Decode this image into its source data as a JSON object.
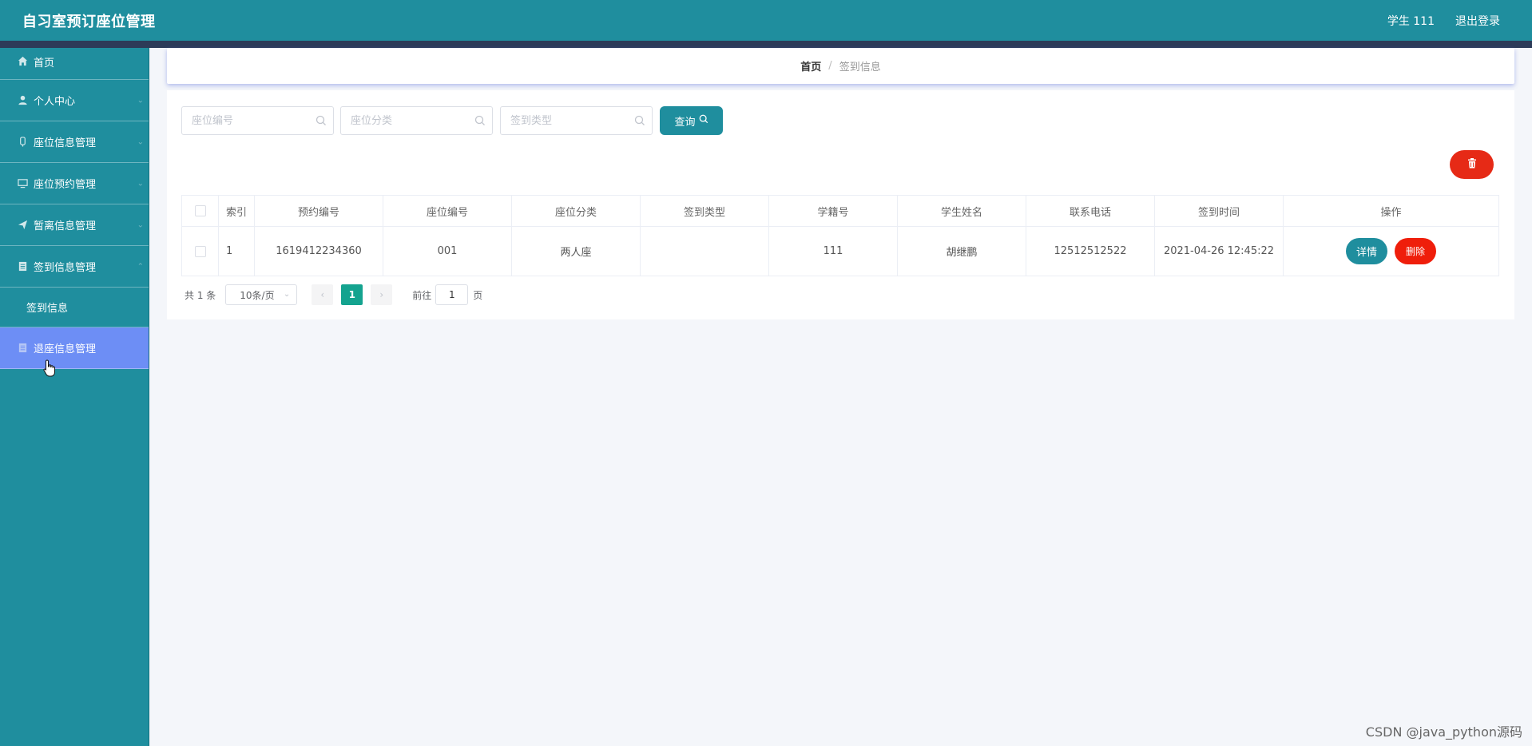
{
  "header": {
    "title": "自习室预订座位管理",
    "user": "学生 111",
    "logout": "退出登录"
  },
  "sidebar": {
    "items": [
      {
        "label": "首页",
        "icon": "home-icon"
      },
      {
        "label": "个人中心",
        "icon": "user-icon"
      },
      {
        "label": "座位信息管理",
        "icon": "seat-icon"
      },
      {
        "label": "座位预约管理",
        "icon": "monitor-icon"
      },
      {
        "label": "暂离信息管理",
        "icon": "send-icon"
      },
      {
        "label": "签到信息管理",
        "icon": "document-icon"
      },
      {
        "label": "退座信息管理",
        "icon": "document-icon"
      }
    ],
    "submenu": {
      "label": "签到信息"
    }
  },
  "breadcrumb": {
    "home": "首页",
    "separator": "/",
    "current": "签到信息"
  },
  "search": {
    "seat_no_placeholder": "座位编号",
    "seat_type_placeholder": "座位分类",
    "checkin_type_placeholder": "签到类型",
    "query_label": "查询"
  },
  "table": {
    "headers": [
      "索引",
      "预约编号",
      "座位编号",
      "座位分类",
      "签到类型",
      "学籍号",
      "学生姓名",
      "联系电话",
      "签到时间",
      "操作"
    ],
    "rows": [
      {
        "index": "1",
        "reservation_no": "1619412234360",
        "seat_no": "001",
        "seat_type": "两人座",
        "checkin_type": "",
        "student_id": "111",
        "student_name": "胡继鹏",
        "phone": "12512512522",
        "checkin_time": "2021-04-26 12:45:22",
        "detail_label": "详情",
        "delete_label": "删除"
      }
    ]
  },
  "pagination": {
    "total": "共 1 条",
    "page_size": "10条/页",
    "current_page": "1",
    "goto_label": "前往",
    "goto_value": "1",
    "page_unit": "页"
  },
  "watermark": "CSDN @java_python源码",
  "colors": {
    "primary": "#1f8e9e",
    "active_menu": "#6d8ef5",
    "danger": "#ef1e0b",
    "pager_active": "#14a38f"
  }
}
